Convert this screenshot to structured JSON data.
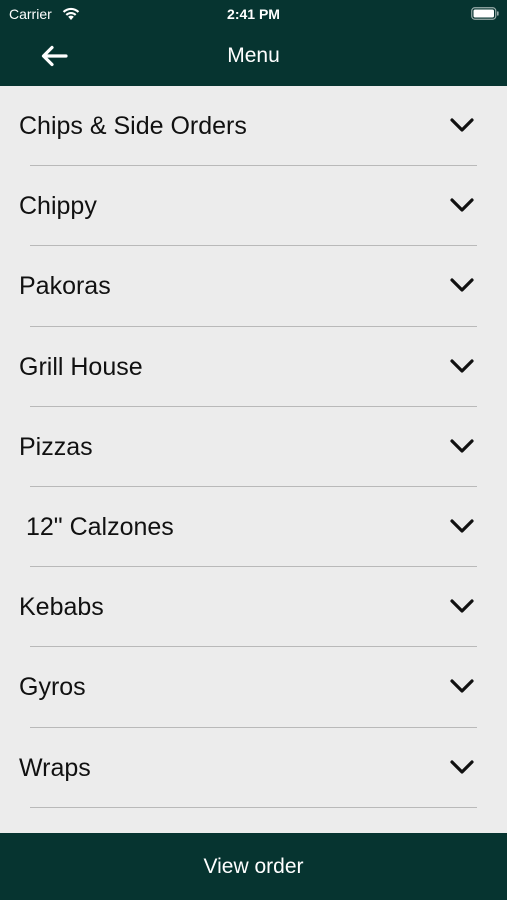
{
  "status_bar": {
    "carrier": "Carrier",
    "time": "2:41 PM"
  },
  "header": {
    "title": "Menu",
    "back_icon": "arrow-left-icon"
  },
  "colors": {
    "header_bg": "#063430",
    "list_bg": "#ececec",
    "divider": "#b9b9b9"
  },
  "menu": {
    "items": [
      {
        "label": "Chips & Side Orders"
      },
      {
        "label": "Chippy"
      },
      {
        "label": "Pakoras"
      },
      {
        "label": "Grill House"
      },
      {
        "label": "Pizzas"
      },
      {
        "label": " 12\" Calzones"
      },
      {
        "label": "Kebabs"
      },
      {
        "label": "Gyros"
      },
      {
        "label": "Wraps"
      }
    ],
    "expand_icon": "chevron-down-icon"
  },
  "footer": {
    "view_order_label": "View order"
  }
}
